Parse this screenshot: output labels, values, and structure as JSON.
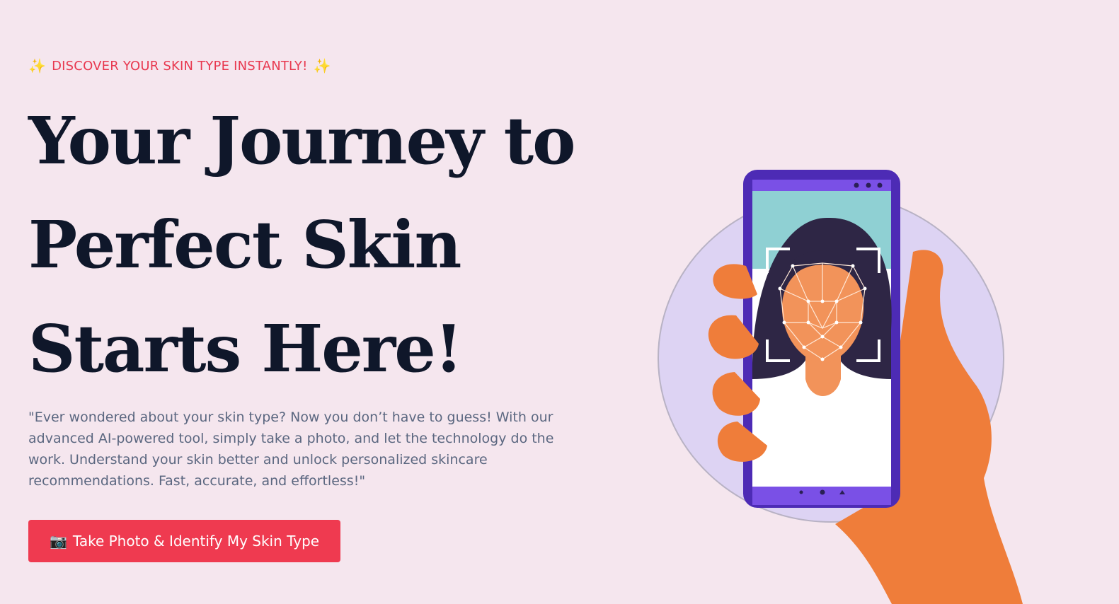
{
  "hero": {
    "eyebrow": "DISCOVER YOUR SKIN TYPE INSTANTLY!",
    "headline": [
      "Your Journey to",
      "Perfect Skin",
      "Starts Here!"
    ],
    "description": "\"Ever wondered about your skin type? Now you don’t have to guess! With our advanced AI-powered tool, simply take a photo, and let the technology do the work. Understand your skin better and unlock personalized skincare recommendations. Fast, accurate, and effortless!\"",
    "cta_label": "Take Photo & Identify My Skin Type"
  },
  "icons": {
    "sparkle": "sparkle-icon",
    "camera": "camera-icon"
  },
  "colors": {
    "background": "#f5e6ee",
    "accent": "#ef3a50",
    "headline": "#0f172a",
    "body_text": "#5b6780",
    "phone": "#6a3fd8",
    "hand": "#ef7d3a",
    "circle": "#ddd3f3"
  }
}
